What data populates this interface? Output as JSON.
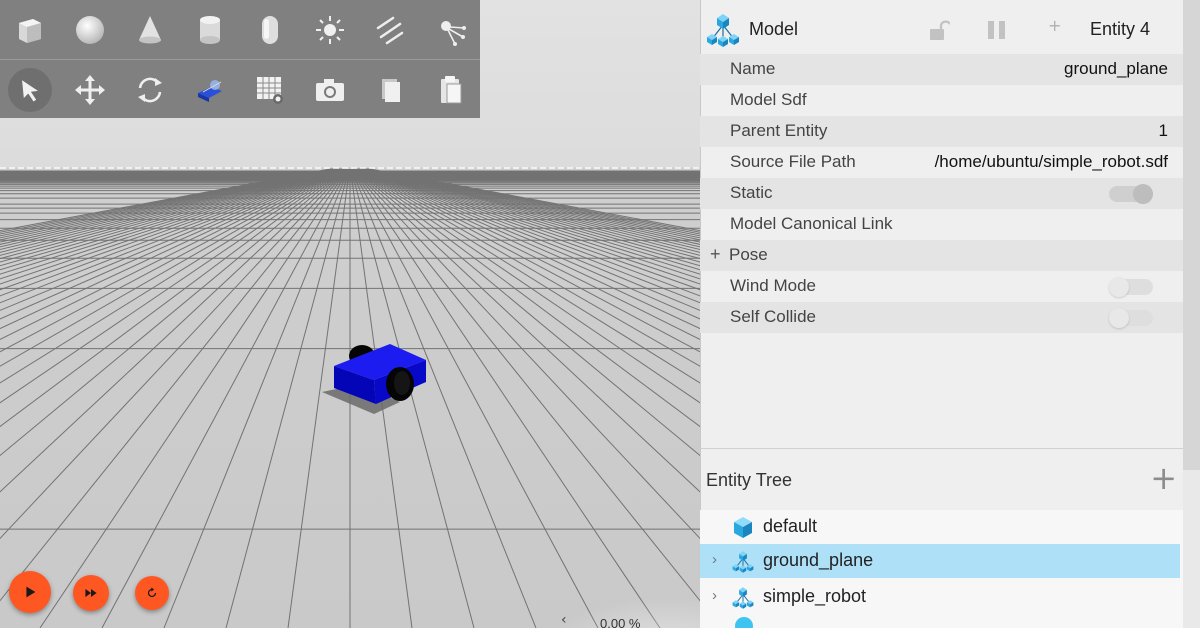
{
  "toolbar": {
    "row1": [
      {
        "icon": "box-icon"
      },
      {
        "icon": "sphere-icon"
      },
      {
        "icon": "cone-icon"
      },
      {
        "icon": "cylinder-icon"
      },
      {
        "icon": "capsule-icon"
      },
      {
        "icon": "point-light-icon"
      },
      {
        "icon": "directional-light-icon"
      },
      {
        "icon": "spot-light-icon"
      }
    ],
    "row2": [
      {
        "icon": "select-arrow-icon",
        "active": true
      },
      {
        "icon": "translate-icon"
      },
      {
        "icon": "rotate-icon"
      },
      {
        "icon": "transform-control-icon"
      },
      {
        "icon": "grid-snap-icon"
      },
      {
        "icon": "screenshot-camera-icon"
      },
      {
        "icon": "copy-icon"
      },
      {
        "icon": "paste-icon"
      }
    ]
  },
  "playback": {
    "play_icon": "play-icon",
    "step_icon": "fast-forward-icon",
    "reset_icon": "reset-icon",
    "accent": "#ff5722"
  },
  "stats": {
    "real_time_factor": "0.00 %"
  },
  "component_inspector": {
    "title": "Model",
    "entity": "Entity 4",
    "properties": [
      {
        "label": "Name",
        "value": "ground_plane"
      },
      {
        "label": "Model Sdf",
        "value": ""
      },
      {
        "label": "Parent Entity",
        "value": "1"
      },
      {
        "label": "Source File Path",
        "value": "/home/ubuntu/simple_robot.sdf"
      },
      {
        "label": "Static",
        "value": ""
      },
      {
        "label": "Model Canonical Link",
        "value": ""
      },
      {
        "label": "Pose",
        "value": ""
      },
      {
        "label": "Wind Mode",
        "value": ""
      },
      {
        "label": "Self Collide",
        "value": ""
      }
    ],
    "pose_expander": "+",
    "toggles": {
      "static": true,
      "wind_mode": false,
      "self_collide": false
    }
  },
  "entity_tree": {
    "title": "Entity Tree",
    "add_label": "+",
    "items": [
      {
        "label": "default",
        "icon": "world-cube-icon",
        "expandable": false,
        "selected": false
      },
      {
        "label": "ground_plane",
        "icon": "model-icon",
        "expandable": true,
        "selected": true
      },
      {
        "label": "simple_robot",
        "icon": "model-icon",
        "expandable": true,
        "selected": false
      }
    ]
  },
  "colors": {
    "accent_blue": "#29a8e0",
    "selection": "#aee0f8",
    "robot_body": "#0a0ad8",
    "toolbar_bg": "#808080"
  }
}
